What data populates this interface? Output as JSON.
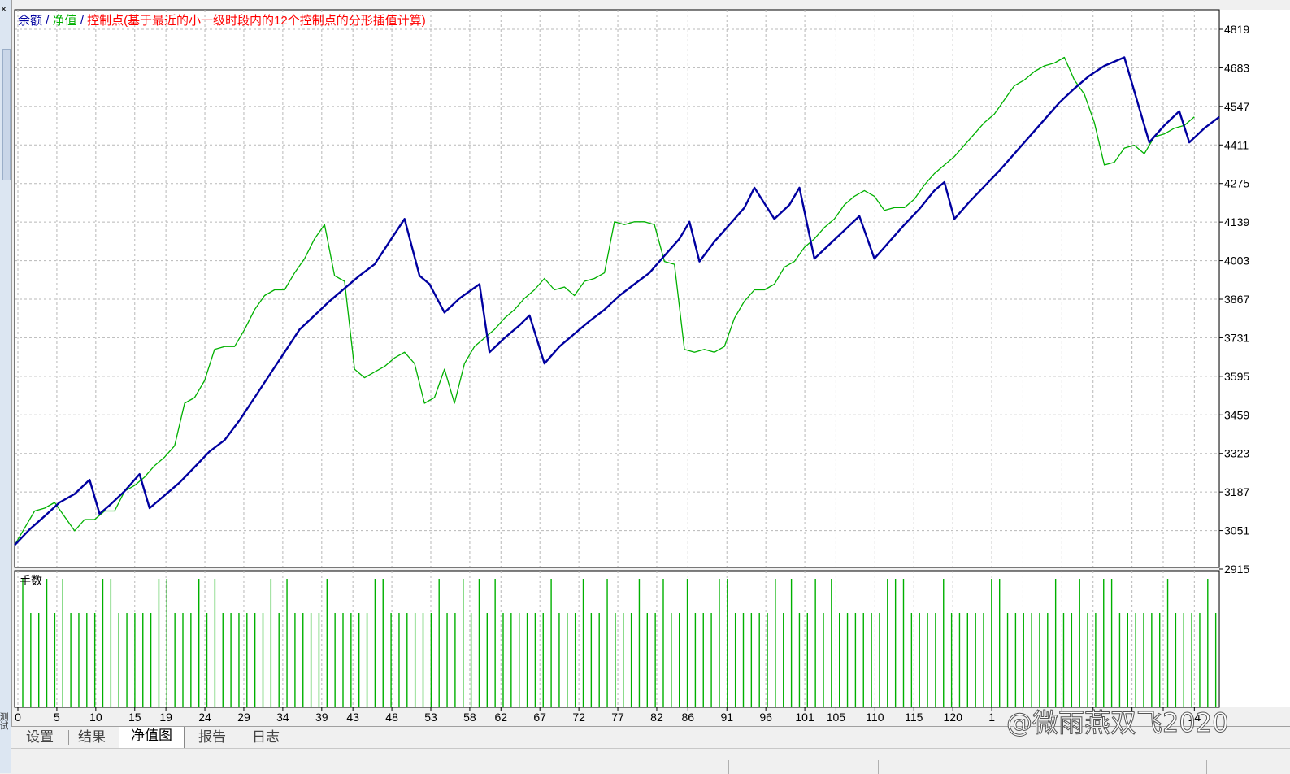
{
  "legend": {
    "balance": "余额",
    "sep1": " / ",
    "equity": "净值",
    "sep2": " / ",
    "control": "控制点(基于最近的小一级时段内的12个控制点的分形插值计算)"
  },
  "colors": {
    "balance": "#0000a0",
    "equity": "#00b000",
    "control": "#ff0000",
    "grid": "#b8b8b8",
    "volume": "#00b000"
  },
  "lots_label": "手数",
  "left_label": "测试",
  "watermark": "@微雨燕双飞2020",
  "tabs": [
    {
      "label": "设置",
      "active": false
    },
    {
      "label": "结果",
      "active": false
    },
    {
      "label": "净值图",
      "active": true
    },
    {
      "label": "报告",
      "active": false
    },
    {
      "label": "日志",
      "active": false
    }
  ],
  "chart_data": {
    "type": "line",
    "ylim": [
      2915,
      4819
    ],
    "y_ticks": [
      4819,
      4683,
      4547,
      4411,
      4275,
      4139,
      4003,
      3867,
      3731,
      3595,
      3459,
      3323,
      3187,
      3051,
      2915
    ],
    "x_ticks": [
      "0",
      "5",
      "10",
      "15",
      "19",
      "24",
      "29",
      "34",
      "39",
      "43",
      "48",
      "53",
      "58",
      "62",
      "67",
      "72",
      "77",
      "82",
      "86",
      "91",
      "96",
      "101",
      "105",
      "110",
      "115",
      "120",
      "1",
      "",
      "",
      "",
      "",
      "",
      "14"
    ],
    "x_tick_pos": [
      0,
      5,
      10,
      15,
      19,
      24,
      29,
      34,
      39,
      43,
      48,
      53,
      58,
      62,
      67,
      72,
      77,
      82,
      86,
      91,
      96,
      101,
      105,
      110,
      115,
      120,
      125,
      129,
      134,
      138,
      143,
      147,
      151
    ],
    "xlim": [
      0,
      156
    ],
    "series": [
      {
        "name": "余额",
        "points": [
          [
            0,
            3000
          ],
          [
            3,
            3055
          ],
          [
            6,
            3102
          ],
          [
            9,
            3150
          ],
          [
            12,
            3180
          ],
          [
            15,
            3230
          ],
          [
            17,
            3110
          ],
          [
            19,
            3140
          ],
          [
            22,
            3190
          ],
          [
            25,
            3250
          ],
          [
            27,
            3130
          ],
          [
            30,
            3175
          ],
          [
            33,
            3220
          ],
          [
            36,
            3275
          ],
          [
            39,
            3330
          ],
          [
            42,
            3370
          ],
          [
            45,
            3440
          ],
          [
            48,
            3520
          ],
          [
            51,
            3600
          ],
          [
            54,
            3680
          ],
          [
            57,
            3760
          ],
          [
            60,
            3810
          ],
          [
            63,
            3860
          ],
          [
            66,
            3905
          ],
          [
            69,
            3950
          ],
          [
            72,
            3990
          ],
          [
            75,
            4070
          ],
          [
            78,
            4150
          ],
          [
            81,
            3950
          ],
          [
            83,
            3920
          ],
          [
            86,
            3820
          ],
          [
            89,
            3870
          ],
          [
            93,
            3920
          ],
          [
            95,
            3680
          ],
          [
            98,
            3730
          ],
          [
            101,
            3775
          ],
          [
            103,
            3810
          ],
          [
            106,
            3640
          ],
          [
            109,
            3700
          ],
          [
            112,
            3745
          ],
          [
            115,
            3790
          ],
          [
            118,
            3830
          ],
          [
            121,
            3880
          ],
          [
            124,
            3920
          ],
          [
            127,
            3960
          ],
          [
            130,
            4020
          ],
          [
            133,
            4080
          ],
          [
            135,
            4140
          ],
          [
            137,
            4000
          ],
          [
            140,
            4070
          ],
          [
            143,
            4130
          ],
          [
            146,
            4190
          ],
          [
            148,
            4260
          ],
          [
            152,
            4150
          ],
          [
            155,
            4200
          ],
          [
            157,
            4260
          ],
          [
            160,
            4010
          ],
          [
            163,
            4060
          ],
          [
            166,
            4110
          ],
          [
            169,
            4160
          ],
          [
            172,
            4010
          ],
          [
            175,
            4070
          ],
          [
            178,
            4130
          ],
          [
            181,
            4185
          ],
          [
            184,
            4250
          ],
          [
            186,
            4280
          ],
          [
            188,
            4150
          ],
          [
            191,
            4210
          ],
          [
            194,
            4265
          ],
          [
            197,
            4320
          ],
          [
            200,
            4380
          ],
          [
            203,
            4440
          ],
          [
            206,
            4500
          ],
          [
            209,
            4560
          ],
          [
            212,
            4610
          ],
          [
            215,
            4655
          ],
          [
            218,
            4690
          ],
          [
            222,
            4720
          ],
          [
            224,
            4600
          ],
          [
            227,
            4420
          ],
          [
            230,
            4480
          ],
          [
            233,
            4530
          ],
          [
            235,
            4420
          ],
          [
            238,
            4470
          ],
          [
            241,
            4510
          ]
        ]
      },
      {
        "name": "净值",
        "points": [
          [
            0,
            3000
          ],
          [
            2,
            3060
          ],
          [
            4,
            3120
          ],
          [
            6,
            3130
          ],
          [
            8,
            3150
          ],
          [
            10,
            3100
          ],
          [
            12,
            3050
          ],
          [
            14,
            3090
          ],
          [
            16,
            3090
          ],
          [
            18,
            3120
          ],
          [
            20,
            3120
          ],
          [
            22,
            3190
          ],
          [
            24,
            3210
          ],
          [
            26,
            3240
          ],
          [
            28,
            3280
          ],
          [
            30,
            3310
          ],
          [
            32,
            3350
          ],
          [
            34,
            3500
          ],
          [
            36,
            3520
          ],
          [
            38,
            3580
          ],
          [
            40,
            3690
          ],
          [
            42,
            3700
          ],
          [
            44,
            3700
          ],
          [
            46,
            3760
          ],
          [
            48,
            3830
          ],
          [
            50,
            3880
          ],
          [
            52,
            3900
          ],
          [
            54,
            3900
          ],
          [
            56,
            3960
          ],
          [
            58,
            4010
          ],
          [
            60,
            4080
          ],
          [
            62,
            4130
          ],
          [
            64,
            3950
          ],
          [
            66,
            3930
          ],
          [
            68,
            3620
          ],
          [
            70,
            3590
          ],
          [
            72,
            3610
          ],
          [
            74,
            3630
          ],
          [
            76,
            3660
          ],
          [
            78,
            3680
          ],
          [
            80,
            3640
          ],
          [
            82,
            3500
          ],
          [
            84,
            3520
          ],
          [
            86,
            3620
          ],
          [
            88,
            3500
          ],
          [
            90,
            3640
          ],
          [
            92,
            3700
          ],
          [
            94,
            3730
          ],
          [
            96,
            3760
          ],
          [
            98,
            3800
          ],
          [
            100,
            3830
          ],
          [
            102,
            3870
          ],
          [
            104,
            3900
          ],
          [
            106,
            3940
          ],
          [
            108,
            3900
          ],
          [
            110,
            3910
          ],
          [
            112,
            3880
          ],
          [
            114,
            3930
          ],
          [
            116,
            3940
          ],
          [
            118,
            3960
          ],
          [
            120,
            4140
          ],
          [
            122,
            4130
          ],
          [
            124,
            4140
          ],
          [
            126,
            4140
          ],
          [
            128,
            4130
          ],
          [
            130,
            4000
          ],
          [
            132,
            3990
          ],
          [
            134,
            3690
          ],
          [
            136,
            3680
          ],
          [
            138,
            3690
          ],
          [
            140,
            3680
          ],
          [
            142,
            3700
          ],
          [
            144,
            3800
          ],
          [
            146,
            3860
          ],
          [
            148,
            3900
          ],
          [
            150,
            3900
          ],
          [
            152,
            3920
          ],
          [
            154,
            3980
          ],
          [
            156,
            4000
          ],
          [
            158,
            4050
          ],
          [
            160,
            4080
          ],
          [
            162,
            4120
          ],
          [
            164,
            4150
          ],
          [
            166,
            4200
          ],
          [
            168,
            4230
          ],
          [
            170,
            4250
          ],
          [
            172,
            4230
          ],
          [
            174,
            4180
          ],
          [
            176,
            4190
          ],
          [
            178,
            4190
          ],
          [
            180,
            4220
          ],
          [
            182,
            4270
          ],
          [
            184,
            4310
          ],
          [
            186,
            4340
          ],
          [
            188,
            4370
          ],
          [
            190,
            4410
          ],
          [
            192,
            4450
          ],
          [
            194,
            4490
          ],
          [
            196,
            4520
          ],
          [
            198,
            4570
          ],
          [
            200,
            4620
          ],
          [
            202,
            4640
          ],
          [
            204,
            4670
          ],
          [
            206,
            4690
          ],
          [
            208,
            4700
          ],
          [
            210,
            4720
          ],
          [
            212,
            4640
          ],
          [
            214,
            4590
          ],
          [
            216,
            4490
          ],
          [
            218,
            4340
          ],
          [
            220,
            4350
          ],
          [
            222,
            4400
          ],
          [
            224,
            4410
          ],
          [
            226,
            4380
          ],
          [
            228,
            4440
          ],
          [
            230,
            4450
          ],
          [
            232,
            4470
          ],
          [
            234,
            4480
          ],
          [
            236,
            4510
          ]
        ]
      }
    ]
  }
}
